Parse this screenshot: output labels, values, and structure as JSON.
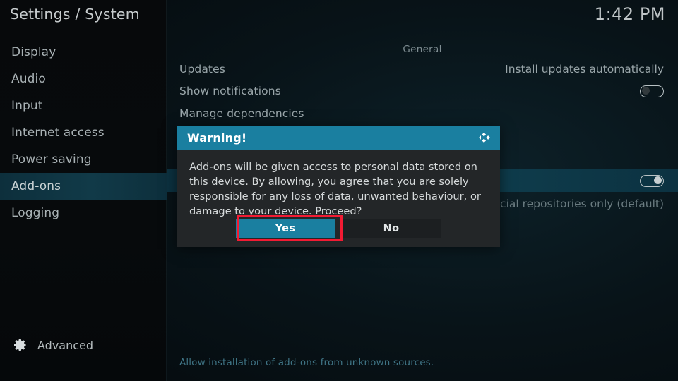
{
  "window": {
    "title": "Settings / System",
    "clock": "1:42 PM"
  },
  "sidebar": {
    "items": [
      {
        "label": "Display",
        "selected": false
      },
      {
        "label": "Audio",
        "selected": false
      },
      {
        "label": "Input",
        "selected": false
      },
      {
        "label": "Internet access",
        "selected": false
      },
      {
        "label": "Power saving",
        "selected": false
      },
      {
        "label": "Add-ons",
        "selected": true
      },
      {
        "label": "Logging",
        "selected": false
      }
    ],
    "advanced": {
      "label": "Advanced",
      "icon": "gear-icon"
    }
  },
  "content": {
    "group_title": "General",
    "rows": [
      {
        "label": "Updates",
        "value": "Install updates automatically",
        "control": "text",
        "highlight": false
      },
      {
        "label": "Show notifications",
        "value": "",
        "control": "toggle",
        "toggle_state": "off",
        "highlight": false
      },
      {
        "label": "Manage dependencies",
        "value": "",
        "control": "none",
        "highlight": false
      },
      {
        "label": "",
        "value": "",
        "control": "none",
        "highlight": false
      },
      {
        "label": "",
        "value": "",
        "control": "toggle",
        "toggle_state": "on",
        "highlight": true
      },
      {
        "label": "",
        "value": "Official repositories only (default)",
        "control": "text",
        "highlight": false,
        "dim": true
      }
    ],
    "help_text": "Allow installation of add-ons from unknown sources."
  },
  "dialog": {
    "title": "Warning!",
    "logo_icon": "kodi-logo-icon",
    "message": "Add-ons will be given access to personal data stored on this device. By allowing, you agree that you are solely responsible for any loss of data, unwanted behaviour, or damage to your device. Proceed?",
    "buttons": {
      "yes": "Yes",
      "no": "No"
    },
    "focused_button": "Yes"
  },
  "colors": {
    "accent": "#1a7fa0",
    "highlight_row": "#0f4050",
    "sidebar_selected": "#113a48",
    "focus_ring": "#f21b33",
    "help_text": "#3f7485"
  }
}
